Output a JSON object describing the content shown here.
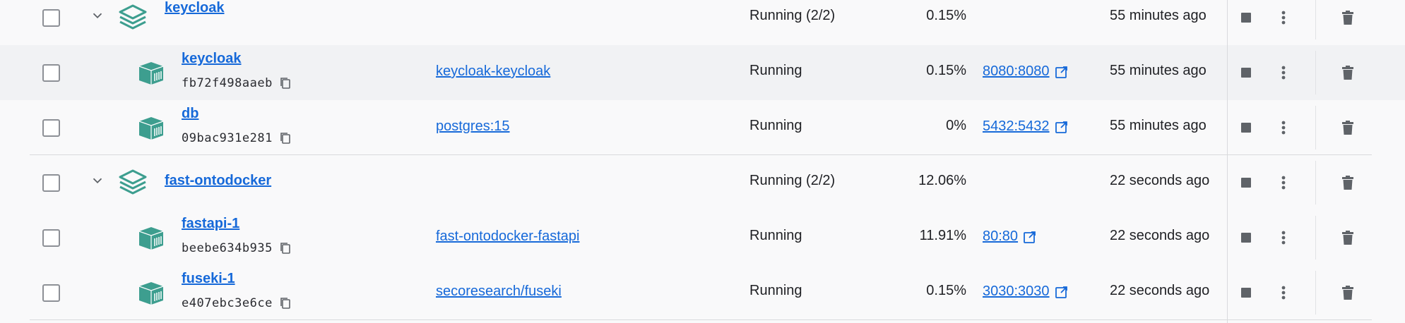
{
  "rows": [
    {
      "kind": "group",
      "name": "keycloak",
      "status": "Running (2/2)",
      "cpu": "0.15%",
      "started": "55 minutes ago"
    },
    {
      "kind": "container",
      "name": "keycloak",
      "id": "fb72f498aaeb",
      "image": "keycloak-keycloak",
      "status": "Running",
      "cpu": "0.15%",
      "port": "8080:8080",
      "started": "55 minutes ago"
    },
    {
      "kind": "container",
      "name": "db",
      "id": "09bac931e281",
      "image": "postgres:15",
      "status": "Running",
      "cpu": "0%",
      "port": "5432:5432",
      "started": "55 minutes ago"
    },
    {
      "kind": "group",
      "name": "fast-ontodocker",
      "status": "Running (2/2)",
      "cpu": "12.06%",
      "started": "22 seconds ago"
    },
    {
      "kind": "container",
      "name": "fastapi-1",
      "id": "beebe634b935",
      "image": "fast-ontodocker-fastapi",
      "status": "Running",
      "cpu": "11.91%",
      "port": "80:80",
      "started": "22 seconds ago"
    },
    {
      "kind": "container",
      "name": "fuseki-1",
      "id": "e407ebc3e6ce",
      "image": "secoresearch/fuseki",
      "status": "Running",
      "cpu": "0.15%",
      "port": "3030:3030",
      "started": "22 seconds ago"
    }
  ],
  "colors": {
    "accent": "#1669d9",
    "icon_teal": "#3d9e8f",
    "action_gray": "#5f6368",
    "row_alt": "#f1f2f4"
  },
  "icons": {
    "group": "stack-icon",
    "container": "container-icon",
    "expand": "chevron-down-icon",
    "copy": "copy-icon",
    "open_port": "external-link-icon",
    "stop": "stop-icon",
    "more": "more-vertical-icon",
    "delete": "trash-icon"
  }
}
